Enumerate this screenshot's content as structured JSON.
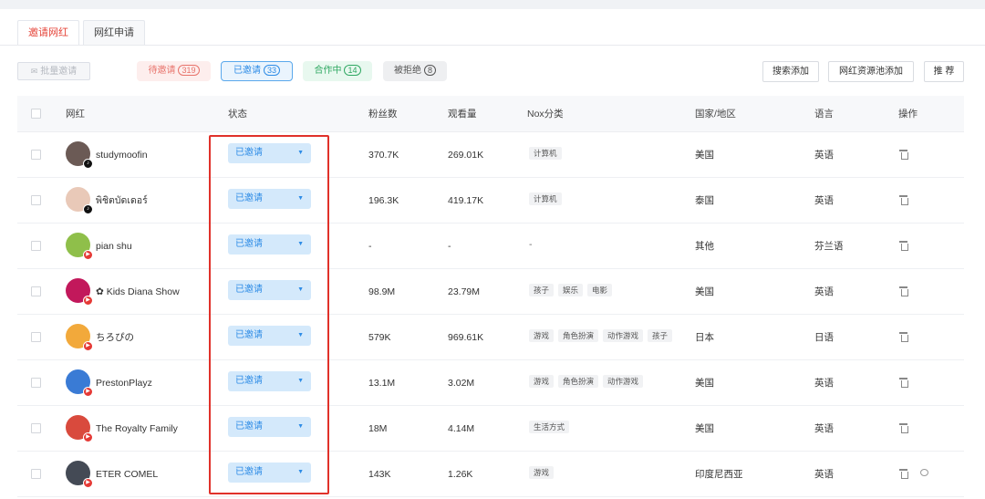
{
  "tabs": [
    {
      "label": "邀请网红",
      "active": true
    },
    {
      "label": "网红申请",
      "active": false
    }
  ],
  "toolbar": {
    "batch_label": "批量邀请",
    "filters": [
      {
        "label": "待邀请",
        "count": "319",
        "key": "pending"
      },
      {
        "label": "已邀请",
        "count": "33",
        "key": "invited"
      },
      {
        "label": "合作中",
        "count": "14",
        "key": "coop"
      },
      {
        "label": "被拒绝",
        "count": "8",
        "key": "rejected"
      }
    ],
    "actions": {
      "search_add": "搜索添加",
      "pool_add": "网红资源池添加",
      "recommend": "推 荐"
    }
  },
  "table": {
    "headers": {
      "influencer": "网红",
      "status": "状态",
      "followers": "粉丝数",
      "views": "观看量",
      "category": "Nox分类",
      "country": "国家/地区",
      "language": "语言",
      "actions": "操作"
    },
    "rows": [
      {
        "name": "studymoofin",
        "platform": "tiktok",
        "status": "已邀请",
        "followers": "370.7K",
        "views": "269.01K",
        "tags": [
          "计算机"
        ],
        "country": "美国",
        "language": "英语",
        "avatar_color": "#6b5a55"
      },
      {
        "name": "พิชิตบัดเดอร์",
        "platform": "tiktok",
        "status": "已邀请",
        "followers": "196.3K",
        "views": "419.17K",
        "tags": [
          "计算机"
        ],
        "country": "泰国",
        "language": "英语",
        "avatar_color": "#e9c9b8"
      },
      {
        "name": "pian shu",
        "platform": "youtube",
        "status": "已邀请",
        "followers": "-",
        "views": "-",
        "tags": [
          "-"
        ],
        "country": "其他",
        "language": "芬兰语",
        "avatar_color": "#8fbf4a"
      },
      {
        "name": "✿ Kids Diana Show",
        "platform": "youtube",
        "status": "已邀请",
        "followers": "98.9M",
        "views": "23.79M",
        "tags": [
          "孩子",
          "娱乐",
          "电影"
        ],
        "country": "美国",
        "language": "英语",
        "avatar_color": "#c2185b"
      },
      {
        "name": "ちろぴの",
        "platform": "youtube",
        "status": "已邀请",
        "followers": "579K",
        "views": "969.61K",
        "tags": [
          "游戏",
          "角色扮演",
          "动作游戏",
          "孩子"
        ],
        "country": "日本",
        "language": "日语",
        "avatar_color": "#f2a93b"
      },
      {
        "name": "PrestonPlayz",
        "platform": "youtube",
        "status": "已邀请",
        "followers": "13.1M",
        "views": "3.02M",
        "tags": [
          "游戏",
          "角色扮演",
          "动作游戏"
        ],
        "country": "美国",
        "language": "英语",
        "avatar_color": "#3a7bd5"
      },
      {
        "name": "The Royalty Family",
        "platform": "youtube",
        "status": "已邀请",
        "followers": "18M",
        "views": "4.14M",
        "tags": [
          "生活方式"
        ],
        "country": "美国",
        "language": "英语",
        "avatar_color": "#d94a3d"
      },
      {
        "name": "ETER COMEL",
        "platform": "youtube",
        "status": "已邀请",
        "followers": "143K",
        "views": "1.26K",
        "tags": [
          "游戏"
        ],
        "country": "印度尼西亚",
        "language": "英语",
        "avatar_color": "#444a55",
        "has_chat": true
      }
    ]
  }
}
